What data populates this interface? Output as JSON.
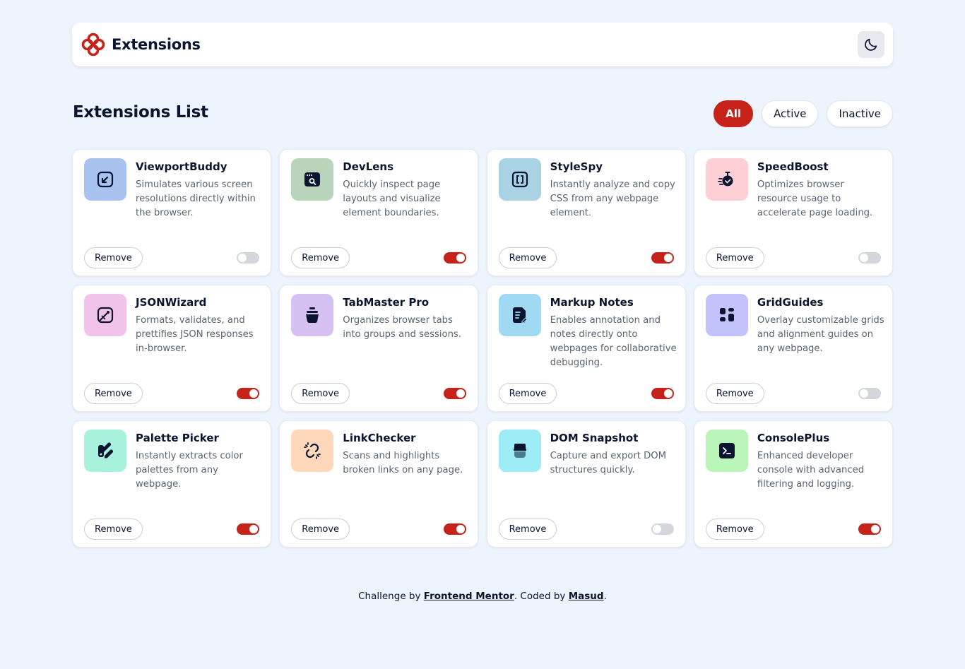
{
  "header": {
    "app_name": "Extensions",
    "logo_icon": "logo-icon",
    "theme_icon": "moon-icon"
  },
  "list": {
    "title": "Extensions List",
    "filters": [
      {
        "label": "All",
        "active": true
      },
      {
        "label": "Active",
        "active": false
      },
      {
        "label": "Inactive",
        "active": false
      }
    ]
  },
  "colors": {
    "accent": "#c7221a",
    "background": "#eef4fd",
    "text": "#0b1530"
  },
  "extensions": [
    {
      "name": "ViewportBuddy",
      "description": "Simulates various screen resolutions directly within the browser.",
      "enabled": false,
      "icon": "viewport-icon",
      "icon_bg": "#a8c3f0",
      "remove_label": "Remove"
    },
    {
      "name": "DevLens",
      "description": "Quickly inspect page layouts and visualize element boundaries.",
      "enabled": true,
      "icon": "devlens-icon",
      "icon_bg": "#bad4bb",
      "remove_label": "Remove"
    },
    {
      "name": "StyleSpy",
      "description": "Instantly analyze and copy CSS from any webpage element.",
      "enabled": true,
      "icon": "stylespy-icon",
      "icon_bg": "#a9d2e3",
      "remove_label": "Remove"
    },
    {
      "name": "SpeedBoost",
      "description": "Optimizes browser resource usage to accelerate page loading.",
      "enabled": false,
      "icon": "speedboost-icon",
      "icon_bg": "#ffcfd6",
      "remove_label": "Remove"
    },
    {
      "name": "JSONWizard",
      "description": "Formats, validates, and prettifies JSON responses in-browser.",
      "enabled": true,
      "icon": "jsonwizard-icon",
      "icon_bg": "#f2c3ea",
      "remove_label": "Remove"
    },
    {
      "name": "TabMaster Pro",
      "description": "Organizes browser tabs into groups and sessions.",
      "enabled": true,
      "icon": "tabmaster-icon",
      "icon_bg": "#d5c2f2",
      "remove_label": "Remove"
    },
    {
      "name": "Markup Notes",
      "description": "Enables annotation and notes directly onto webpages for collaborative debugging.",
      "enabled": true,
      "icon": "markup-notes-icon",
      "icon_bg": "#9fdaf2",
      "remove_label": "Remove"
    },
    {
      "name": "GridGuides",
      "description": "Overlay customizable grids and alignment guides on any webpage.",
      "enabled": false,
      "icon": "gridguides-icon",
      "icon_bg": "#c3c2fb",
      "remove_label": "Remove"
    },
    {
      "name": "Palette Picker",
      "description": "Instantly extracts color palettes from any webpage.",
      "enabled": true,
      "icon": "palette-icon",
      "icon_bg": "#a8f2dd",
      "remove_label": "Remove"
    },
    {
      "name": "LinkChecker",
      "description": "Scans and highlights broken links on any page.",
      "enabled": true,
      "icon": "linkchecker-icon",
      "icon_bg": "#ffd8bb",
      "remove_label": "Remove"
    },
    {
      "name": "DOM Snapshot",
      "description": "Capture and export DOM structures quickly.",
      "enabled": false,
      "icon": "dom-snapshot-icon",
      "icon_bg": "#9eecf5",
      "remove_label": "Remove"
    },
    {
      "name": "ConsolePlus",
      "description": "Enhanced developer console with advanced filtering and logging.",
      "enabled": true,
      "icon": "console-icon",
      "icon_bg": "#b9f4b9",
      "remove_label": "Remove"
    }
  ],
  "footer": {
    "prefix": "Challenge by ",
    "link1": "Frontend Mentor",
    "middle": ". Coded by ",
    "link2": "Masud",
    "suffix": "."
  }
}
